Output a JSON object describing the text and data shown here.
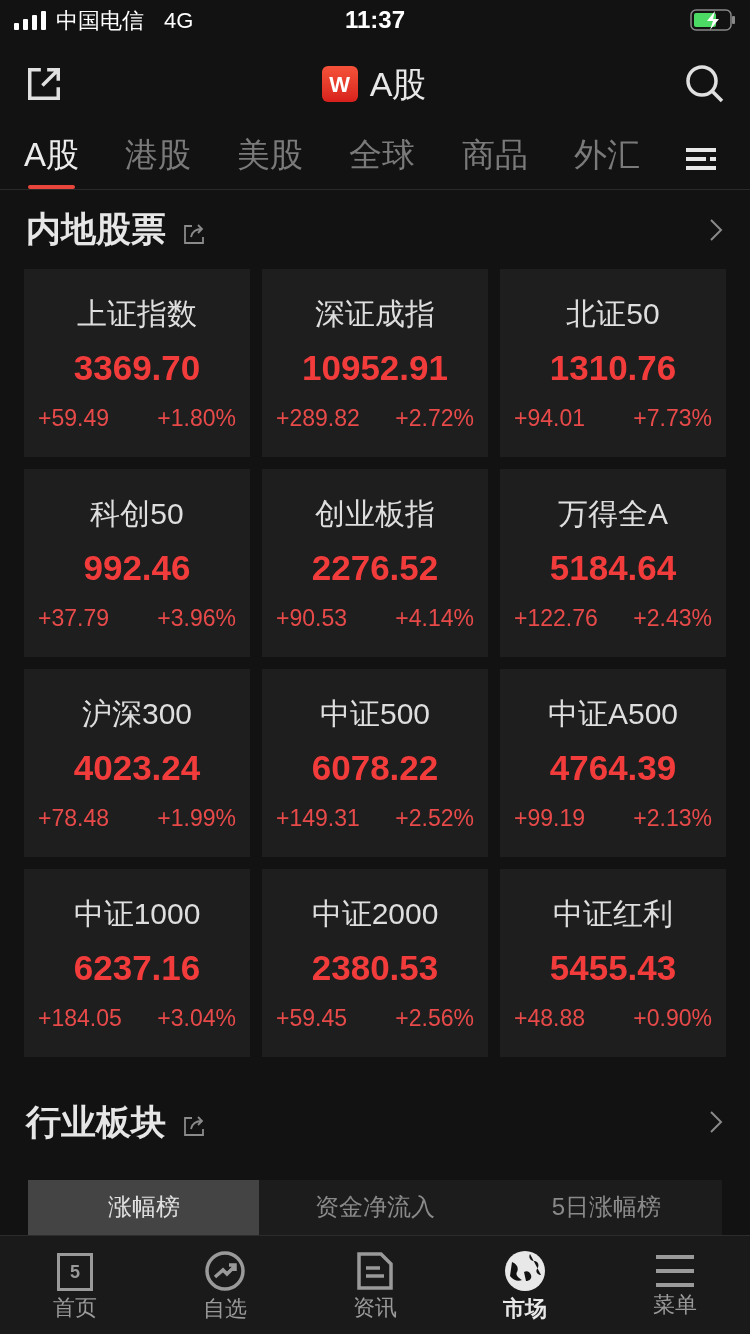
{
  "status_bar": {
    "carrier": "中国电信",
    "network": "4G",
    "time": "11:37"
  },
  "header": {
    "logo": "W",
    "title": "A股"
  },
  "tabs": [
    {
      "label": "A股",
      "selected": true
    },
    {
      "label": "港股",
      "selected": false
    },
    {
      "label": "美股",
      "selected": false
    },
    {
      "label": "全球",
      "selected": false
    },
    {
      "label": "商品",
      "selected": false
    },
    {
      "label": "外汇",
      "selected": false
    }
  ],
  "section_1": {
    "title": "内地股票"
  },
  "indices": [
    {
      "name": "上证指数",
      "value": "3369.70",
      "change": "+59.49",
      "percent": "+1.80%"
    },
    {
      "name": "深证成指",
      "value": "10952.91",
      "change": "+289.82",
      "percent": "+2.72%"
    },
    {
      "name": "北证50",
      "value": "1310.76",
      "change": "+94.01",
      "percent": "+7.73%"
    },
    {
      "name": "科创50",
      "value": "992.46",
      "change": "+37.79",
      "percent": "+3.96%"
    },
    {
      "name": "创业板指",
      "value": "2276.52",
      "change": "+90.53",
      "percent": "+4.14%"
    },
    {
      "name": "万得全A",
      "value": "5184.64",
      "change": "+122.76",
      "percent": "+2.43%"
    },
    {
      "name": "沪深300",
      "value": "4023.24",
      "change": "+78.48",
      "percent": "+1.99%"
    },
    {
      "name": "中证500",
      "value": "6078.22",
      "change": "+149.31",
      "percent": "+2.52%"
    },
    {
      "name": "中证A500",
      "value": "4764.39",
      "change": "+99.19",
      "percent": "+2.13%"
    },
    {
      "name": "中证1000",
      "value": "6237.16",
      "change": "+184.05",
      "percent": "+3.04%"
    },
    {
      "name": "中证2000",
      "value": "2380.53",
      "change": "+59.45",
      "percent": "+2.56%"
    },
    {
      "name": "中证红利",
      "value": "5455.43",
      "change": "+48.88",
      "percent": "+0.90%"
    }
  ],
  "section_2": {
    "title": "行业板块"
  },
  "segments": [
    {
      "label": "涨幅榜",
      "selected": true
    },
    {
      "label": "资金净流入",
      "selected": false
    },
    {
      "label": "5日涨幅榜",
      "selected": false
    }
  ],
  "bottom_nav": [
    {
      "kind": "calendar",
      "label": "首页",
      "icon_text": "5",
      "selected": false
    },
    {
      "kind": "trend",
      "label": "自选",
      "selected": false
    },
    {
      "kind": "news",
      "label": "资讯",
      "selected": false
    },
    {
      "kind": "globe",
      "label": "市场",
      "selected": true
    },
    {
      "kind": "menu",
      "label": "菜单",
      "selected": false
    }
  ]
}
